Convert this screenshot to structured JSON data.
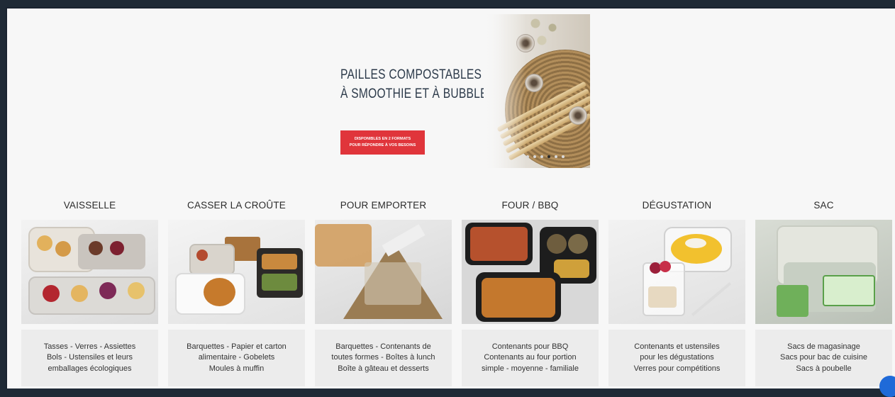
{
  "hero": {
    "title_line1": "PAILLES COMPOSTABLES",
    "title_line2": "À SMOOTHIE ET À BUBBLE TEA",
    "cta_line1": "DISPONIBLES EN 2 FORMATS",
    "cta_line2": "POUR RÉPONDRE À VOS BESOINS",
    "carousel": {
      "slides": 6,
      "active_index": 3
    }
  },
  "categories": [
    {
      "title": "VAISSELLE",
      "lines": [
        "Tasses - Verres - Assiettes",
        "Bols - Ustensiles et leurs",
        "emballages écologiques"
      ]
    },
    {
      "title": "CASSER LA CROÛTE",
      "lines": [
        "Barquettes - Papier et carton",
        "alimentaire - Gobelets",
        "Moules à muffin"
      ]
    },
    {
      "title": "POUR EMPORTER",
      "lines": [
        "Barquettes - Contenants de",
        "toutes formes - Boîtes à lunch",
        "Boîte à gâteau et desserts"
      ]
    },
    {
      "title": "FOUR / BBQ",
      "lines": [
        "Contenants pour BBQ",
        "Contenants au four portion",
        "simple - moyenne - familiale"
      ]
    },
    {
      "title": "DÉGUSTATION",
      "lines": [
        "Contenants et ustensiles",
        "pour les dégustations",
        "Verres pour compétitions"
      ]
    },
    {
      "title": "SAC",
      "lines": [
        "Sacs de magasinage",
        "Sacs pour bac de cuisine",
        "Sacs à poubelle"
      ]
    }
  ],
  "colors": {
    "cta": "#e0353b",
    "title": "#2c3a4a",
    "background": "#f7f7f7",
    "desc_box": "#ececec"
  }
}
